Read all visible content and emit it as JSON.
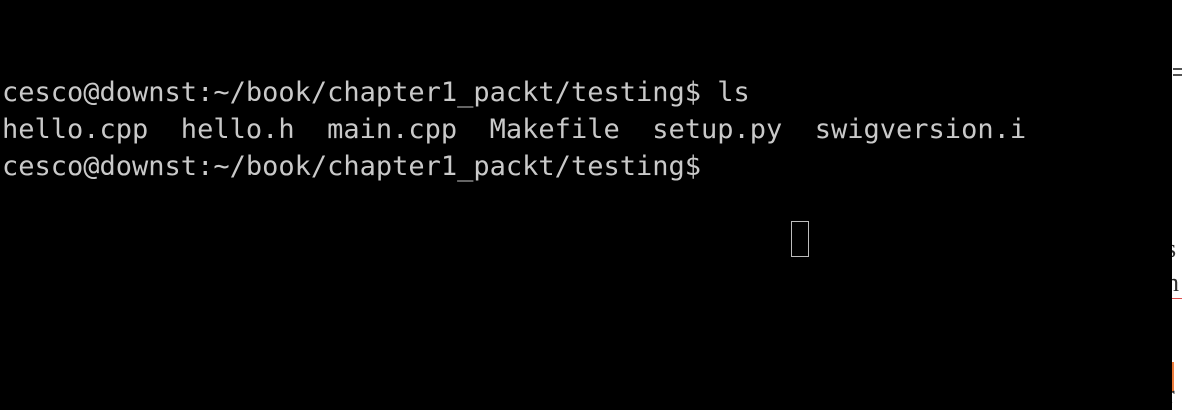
{
  "terminal": {
    "lines": [
      "cesco@downst:~/book/chapter1_packt/testing$ ls",
      "hello.cpp  hello.h  main.cpp  Makefile  setup.py  swigversion.i",
      "cesco@downst:~/book/chapter1_packt/testing$ "
    ],
    "background_color": "#000000",
    "text_color": "#c9c9c9"
  },
  "background_window": {
    "partial_glyphs": [
      "s",
      "h",
      "r"
    ]
  }
}
